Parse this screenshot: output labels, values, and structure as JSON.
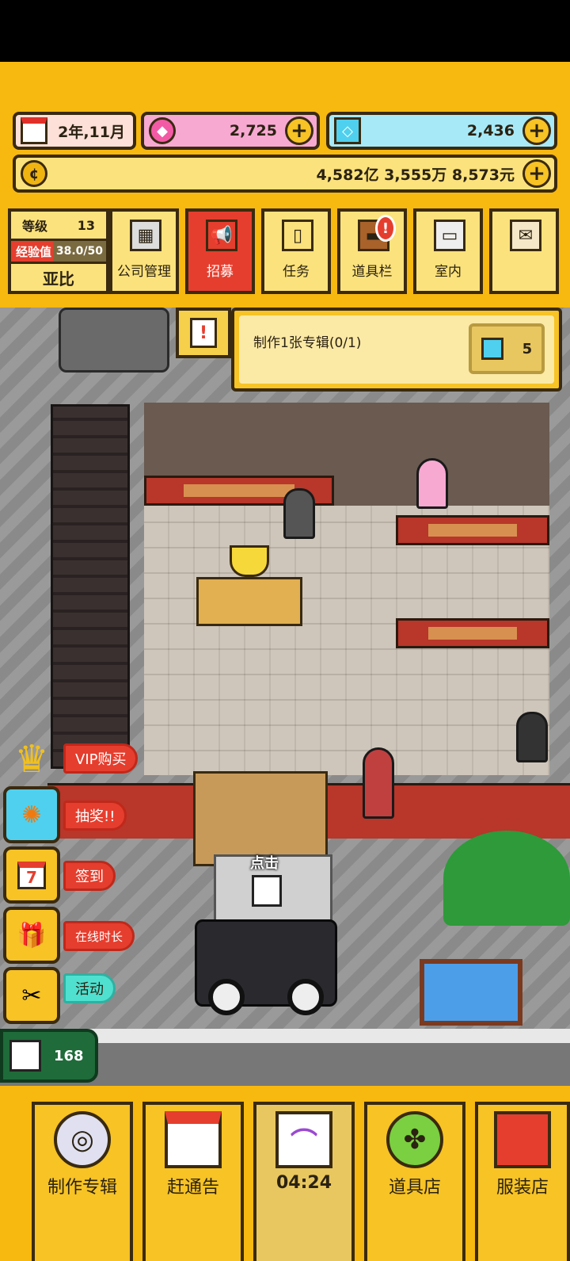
{
  "resources": {
    "date": "2年,11月",
    "gems": "2,725",
    "diamonds": "2,436",
    "money": "4,582亿 3,555万 8,573元",
    "plus_label": "+"
  },
  "player": {
    "level_label": "等级",
    "level": "13",
    "exp_label": "经验值",
    "exp_value": "38.0/50",
    "exp_progress": 0.76,
    "name": "亚比"
  },
  "menu": [
    {
      "label": "公司管理",
      "icon": "building-icon"
    },
    {
      "label": "招募",
      "icon": "megaphone-icon",
      "active": true
    },
    {
      "label": "任务",
      "icon": "scroll-icon"
    },
    {
      "label": "道具栏",
      "icon": "treasure-chest-icon",
      "badge": "!"
    },
    {
      "label": "室内",
      "icon": "paint-roller-icon"
    },
    {
      "label": "",
      "icon": "mail-hammer-icon"
    }
  ],
  "quest": {
    "icon_text": "!",
    "text": "制作1张专辑(0/1)",
    "reward": "5"
  },
  "side": {
    "vip": "VIP购买",
    "lottery": "抽奖!!",
    "checkin": "签到",
    "checkin_icon_text": "7",
    "online": "在线时长",
    "event": "活动"
  },
  "dog_count": "168",
  "tap_hint": "点击",
  "bottom": [
    {
      "label": "制作专辑",
      "icon": "cd-icon"
    },
    {
      "label": "赶通告",
      "icon": "calendar-icon"
    },
    {
      "label": "04:24",
      "icon": "rainbow-icon"
    },
    {
      "label": "道具店",
      "icon": "clover-icon"
    },
    {
      "label": "服装店",
      "icon": "shirt-icon"
    }
  ],
  "colors": {
    "accent": "#f7b80f",
    "active": "#e53e2e",
    "border": "#3a2a10",
    "gem": "#f35aa5",
    "diamond": "#4fd0ee"
  }
}
